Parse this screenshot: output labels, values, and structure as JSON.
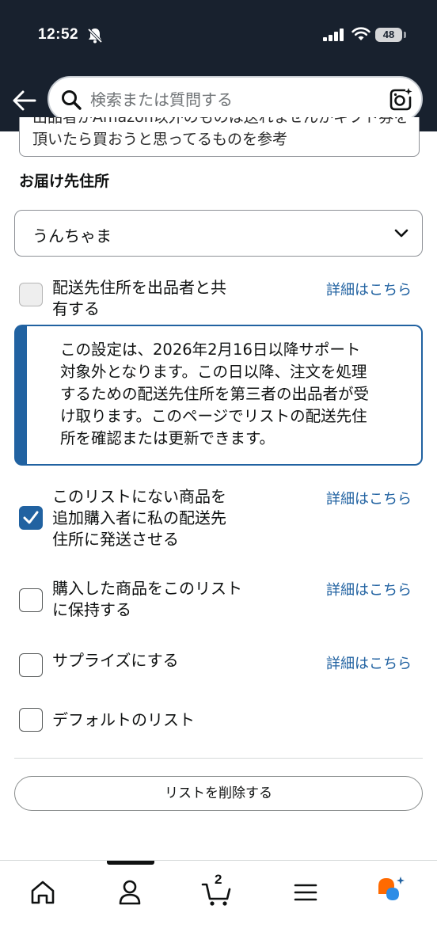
{
  "status_bar": {
    "time": "12:52",
    "battery": "48"
  },
  "search": {
    "placeholder": "検索または質問する",
    "value": ""
  },
  "notes": {
    "text": "出品者がAmazon以外のものは送れませんがギフト券を頂いたら買おうと思ってるものを参考"
  },
  "address": {
    "section_title": "お届け先住所",
    "selected": "うんちゃま"
  },
  "options": [
    {
      "label_lines": [
        "配送先住所を出品者と共",
        "有する"
      ],
      "checked": false,
      "disabled": true,
      "link": "詳細はこちら"
    },
    {
      "label_lines": [
        "このリストにない商品を",
        "追加購入者に私の配送先",
        "住所に発送させる"
      ],
      "checked": true,
      "disabled": false,
      "link": "詳細はこちら"
    },
    {
      "label_lines": [
        "購入した商品をこのリスト",
        "に保持する"
      ],
      "checked": false,
      "disabled": false,
      "link": "詳細はこちら"
    },
    {
      "label_lines": [
        "サプライズにする"
      ],
      "checked": false,
      "disabled": false,
      "link": "詳細はこちら"
    },
    {
      "label_lines": [
        "デフォルトのリスト"
      ],
      "checked": false,
      "disabled": false
    }
  ],
  "info_notice": {
    "lines": [
      "この設定は、2026年2月16日以降サポート",
      "対象外となります。この日以降、注文を処理",
      "するための配送先住所を第三者の出品者が受",
      "け取ります。このページでリストの配送先住",
      "所を確認または更新できます。"
    ]
  },
  "delete_button": {
    "label": "リストを削除する"
  },
  "bottom_nav": {
    "cart_count": "2",
    "items": [
      {
        "icon": "home-icon"
      },
      {
        "icon": "account-icon"
      },
      {
        "icon": "cart-icon"
      },
      {
        "icon": "menu-icon"
      },
      {
        "icon": "rufus-ai-icon"
      }
    ]
  },
  "colors": {
    "header_bg": "#18212e",
    "link": "#2162a1",
    "checkbox_checked": "#2162a1",
    "ai_orange": "#ff6a00",
    "ai_blue": "#2e8de6"
  }
}
